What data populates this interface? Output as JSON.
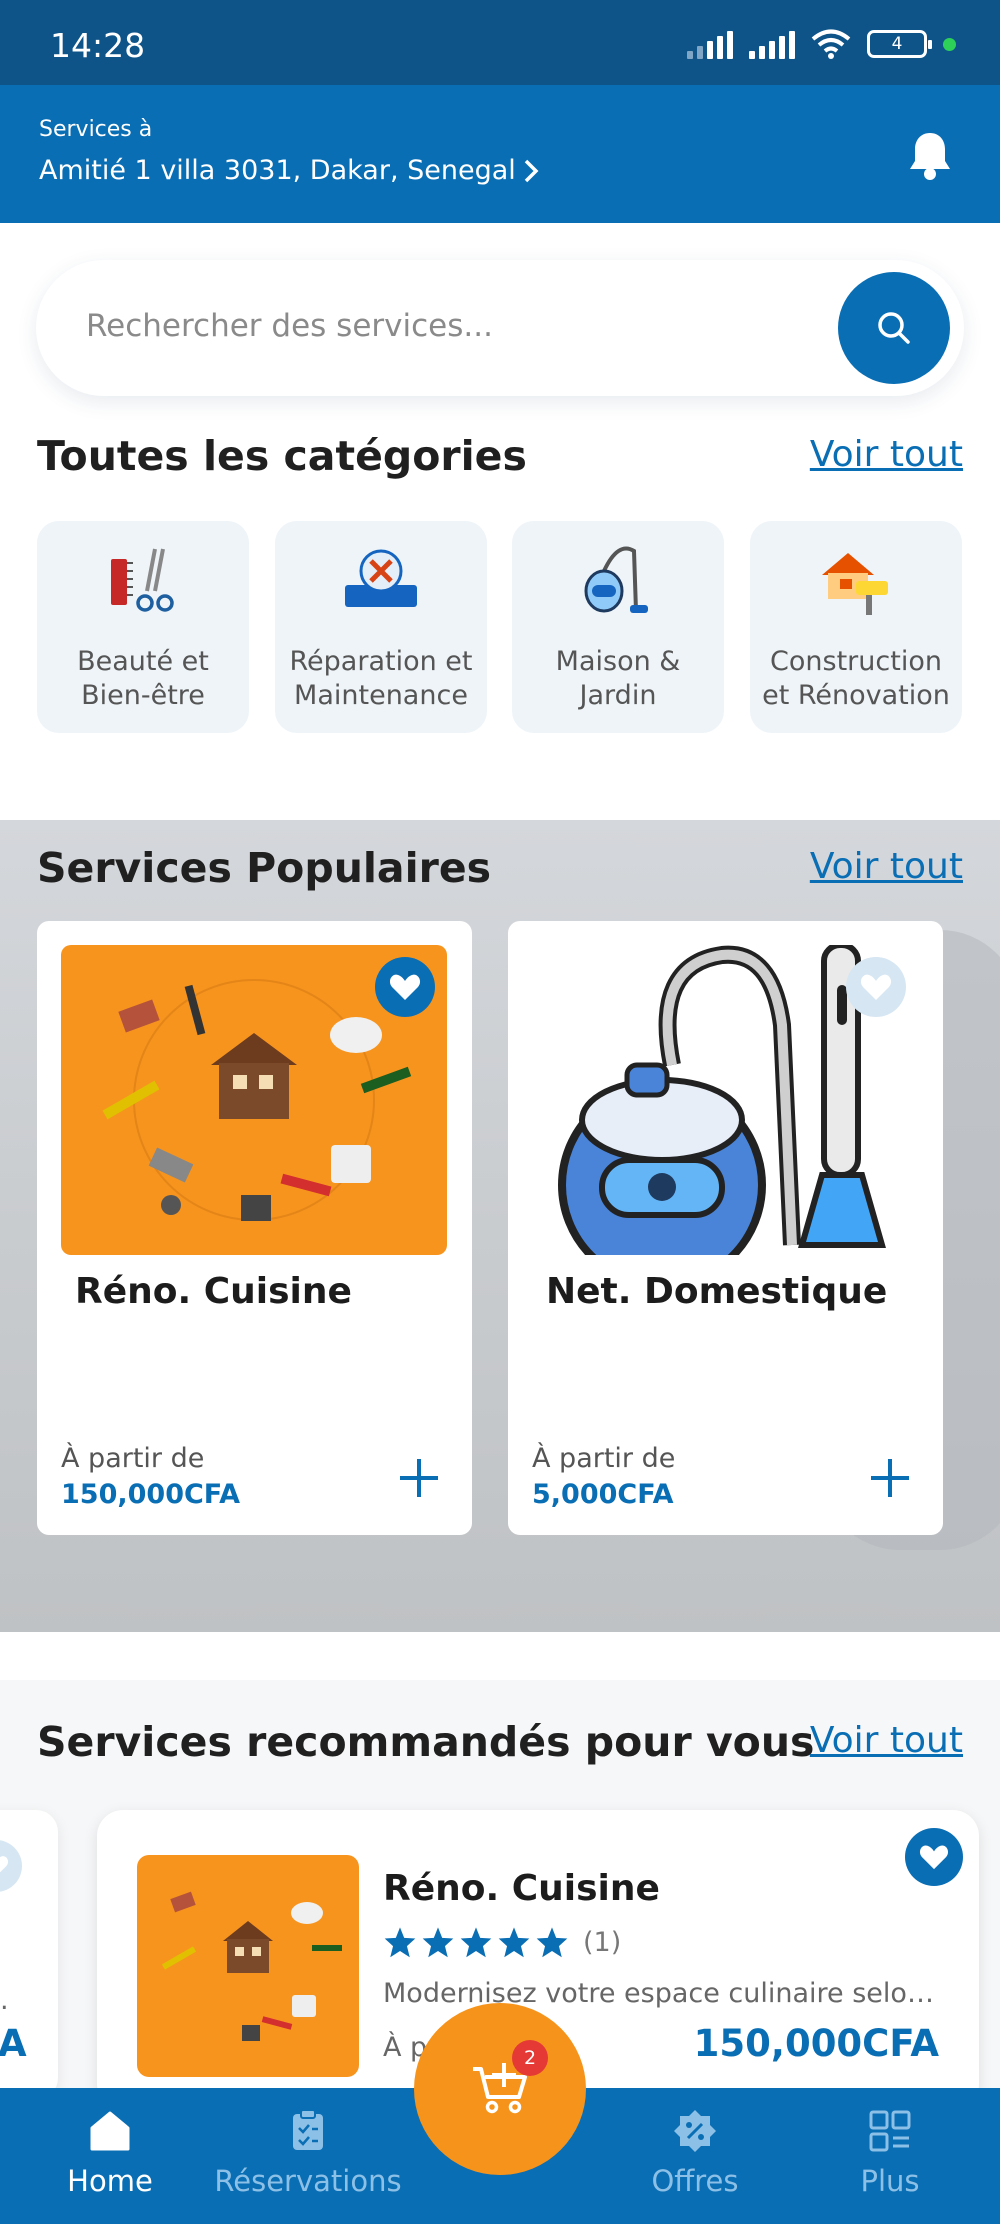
{
  "status_bar": {
    "time": "14:28",
    "battery": "4"
  },
  "header": {
    "label": "Services à",
    "address": "Amitié 1 villa 3031, Dakar, Senegal"
  },
  "search": {
    "placeholder": "Rechercher des services..."
  },
  "categories_section": {
    "title": "Toutes les catégories",
    "see_all": "Voir tout",
    "items": [
      {
        "label": "Beauté et\nBien-être",
        "icon": "scissors-comb-icon"
      },
      {
        "label": "Réparation et\nMaintenance",
        "icon": "tools-icon"
      },
      {
        "label": "Maison &\nJardin",
        "icon": "vacuum-icon"
      },
      {
        "label": "Construction\net Rénovation",
        "icon": "house-roller-icon"
      }
    ]
  },
  "popular_section": {
    "title": "Services Populaires",
    "see_all": "Voir tout",
    "items": [
      {
        "title": "Réno. Cuisine",
        "from_label": "À partir de",
        "price": "150,000CFA",
        "favorited": true
      },
      {
        "title": "Net. Domestique",
        "from_label": "À partir de",
        "price": "5,000CFA",
        "favorited": false
      }
    ]
  },
  "recommended_section": {
    "title": "Services recommandés pour vous",
    "see_all": "Voir tout",
    "item": {
      "title": "Réno. Cuisine",
      "rating": 5,
      "reviews": "(1)",
      "description": "Modernisez votre espace culinaire selon vos goûts",
      "from_label": "À p",
      "price": "150,000CFA",
      "favorited": true
    },
    "partial_card": {
      "price_fragment": "A",
      "dot": "."
    }
  },
  "bottom_nav": {
    "items": [
      {
        "label": "Home",
        "icon": "home-icon",
        "active": true
      },
      {
        "label": "Réservations",
        "icon": "clipboard-icon",
        "active": false
      },
      {
        "label": "Offres",
        "icon": "discount-badge-icon",
        "active": false
      },
      {
        "label": "Plus",
        "icon": "grid-icon",
        "active": false
      }
    ],
    "cart_count": "2"
  },
  "colors": {
    "primary": "#0a6eb4",
    "status_bar": "#0e5489",
    "accent_orange": "#f6931b",
    "badge_red": "#e53935"
  }
}
